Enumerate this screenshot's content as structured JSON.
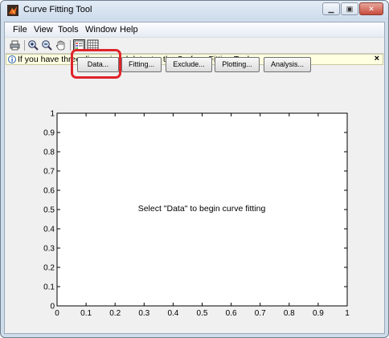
{
  "window": {
    "title": "Curve Fitting Tool",
    "controls": [
      "minimize",
      "maximize",
      "close"
    ]
  },
  "menu": [
    "File",
    "View",
    "Tools",
    "Window",
    "Help"
  ],
  "toolbar": {
    "icons": [
      "print-icon",
      "zoom-in-icon",
      "zoom-out-icon",
      "pan-hand-icon",
      "legend-toggle-icon",
      "grid-toggle-icon"
    ]
  },
  "infobar": {
    "message": "If you have three dimensional data, try the Surface Fitting Tool",
    "close": "×"
  },
  "buttons": {
    "data": "Data...",
    "fitting": "Fitting...",
    "exclude": "Exclude...",
    "plotting": "Plotting...",
    "analysis": "Analysis..."
  },
  "plot": {
    "message": "Select \"Data\" to begin curve fitting",
    "x_ticks": [
      "0",
      "0.1",
      "0.2",
      "0.3",
      "0.4",
      "0.5",
      "0.6",
      "0.7",
      "0.8",
      "0.9",
      "1"
    ],
    "y_ticks": [
      "0",
      "0.1",
      "0.2",
      "0.3",
      "0.4",
      "0.5",
      "0.6",
      "0.7",
      "0.8",
      "0.9",
      "1"
    ],
    "xlim": [
      0,
      1
    ],
    "ylim": [
      0,
      1
    ]
  },
  "colors": {
    "highlight": "#e0232a",
    "infobar_bg": "#ffffe1"
  }
}
